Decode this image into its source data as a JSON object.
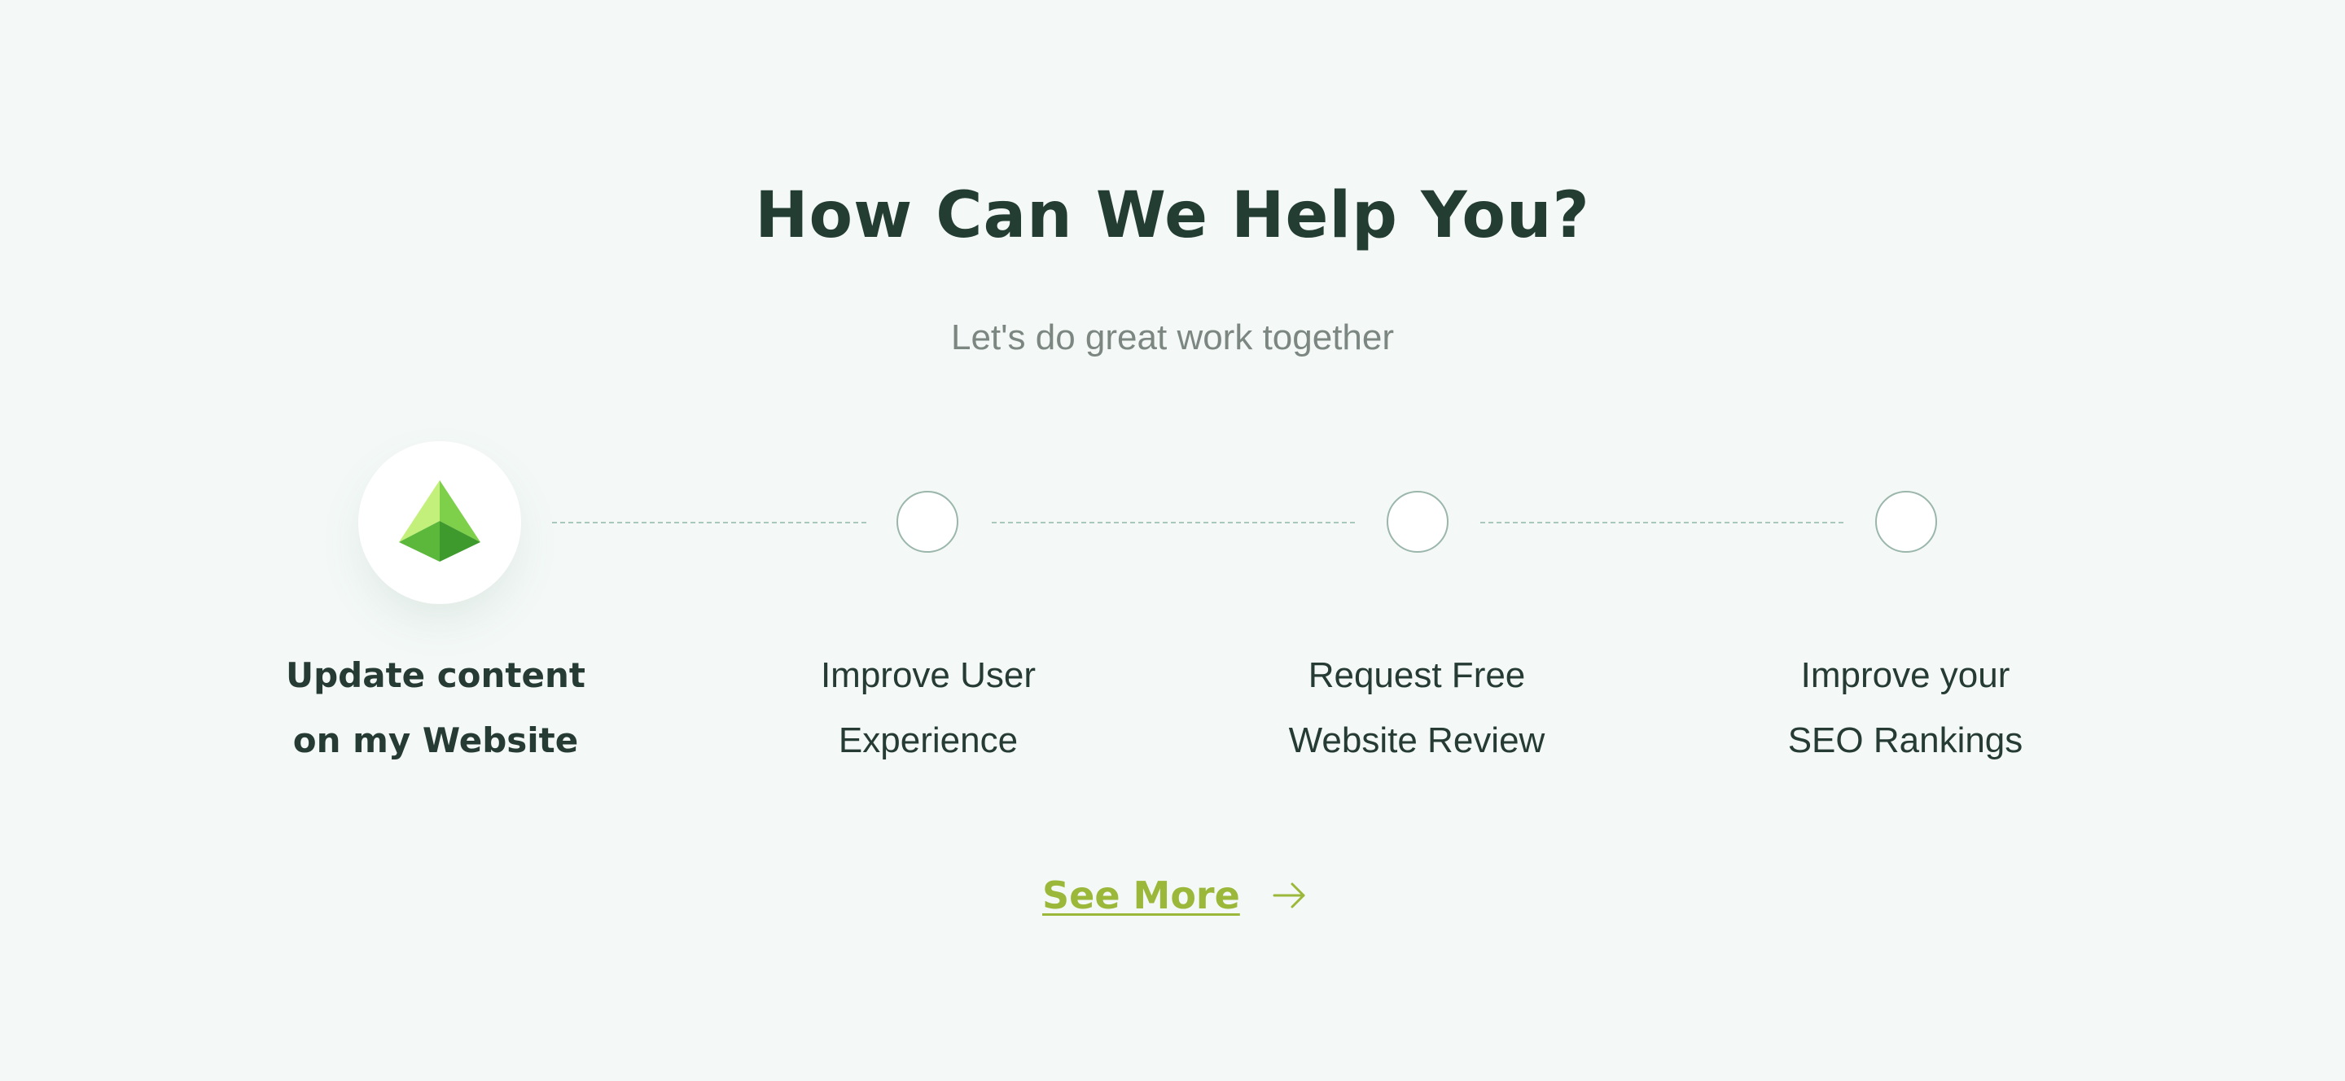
{
  "section": {
    "title": "How Can We Help You?",
    "subtitle": "Let's do great work together"
  },
  "steps": [
    {
      "line1": "Update content",
      "line2": "on my Website",
      "active": true,
      "icon": "pyramid-icon"
    },
    {
      "line1": "Improve User",
      "line2": "Experience",
      "active": false
    },
    {
      "line1": "Request Free",
      "line2": "Website Review",
      "active": false
    },
    {
      "line1": "Improve your",
      "line2": "SEO Rankings",
      "active": false
    }
  ],
  "cta": {
    "label": "See More",
    "icon": "arrow-right-icon"
  },
  "colors": {
    "background": "#f4f9f7",
    "heading": "#243d33",
    "subtitle": "#7d8782",
    "accent": "#9bb83a",
    "connector": "#a9c7bb"
  }
}
